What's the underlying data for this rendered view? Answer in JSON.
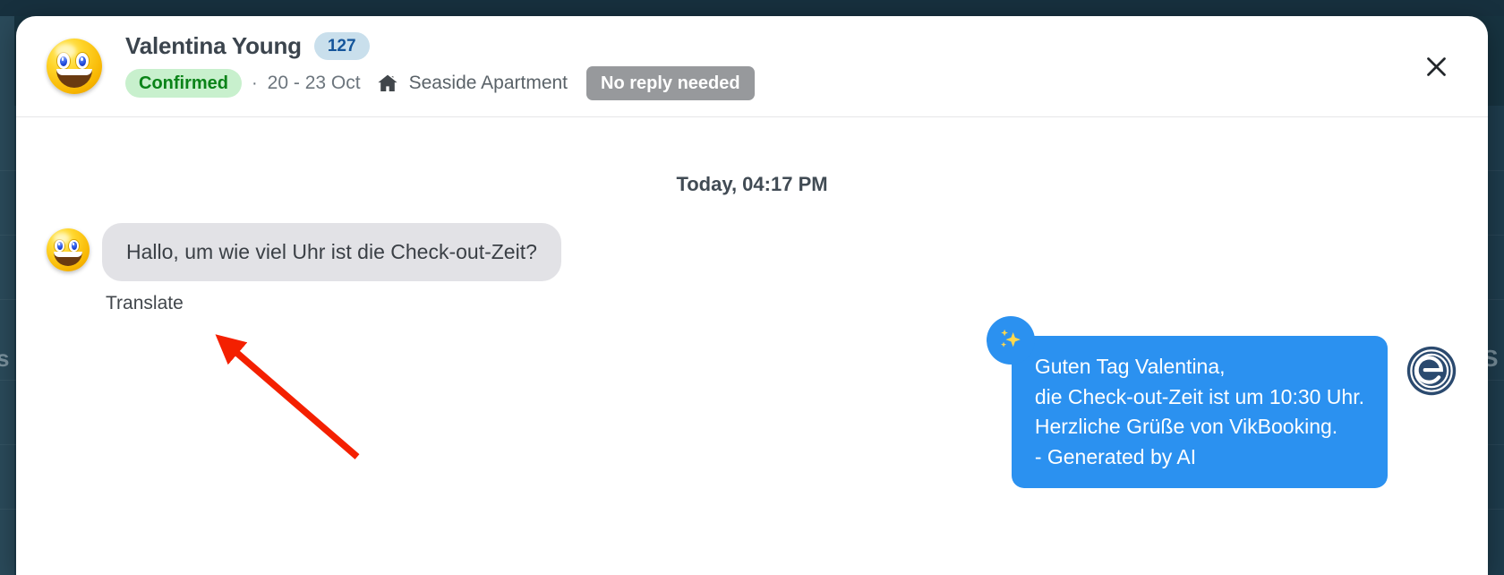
{
  "header": {
    "guest_name": "Valentina Young",
    "booking_id": "127",
    "status": "Confirmed",
    "separator": "·",
    "date_range": "20 - 23 Oct",
    "house_icon": "house-icon",
    "room_name": "Seaside Apartment",
    "reply_badge": "No reply needed",
    "close_icon": "close-icon",
    "avatar_icon": "smiley-avatar",
    "colors": {
      "booking_badge_bg": "#c9dfec",
      "booking_badge_text": "#14559b",
      "status_badge_bg": "#c8f0cd",
      "status_badge_text": "#0a8318",
      "reply_badge_bg": "#97999c",
      "reply_badge_text": "#ffffff"
    }
  },
  "conversation": {
    "day_divider": "Today, 04:17 PM",
    "incoming": {
      "avatar_icon": "smiley-avatar",
      "text": "Hallo, um wie viel Uhr ist die Check-out-Zeit?",
      "translate_label": "Translate",
      "bubble_bg": "#e2e2e6"
    },
    "outgoing": {
      "ai_badge_icon": "sparkles-icon",
      "text": "Guten Tag Valentina,\ndie Check-out-Zeit ist um 10:30 Uhr.\nHerzliche Grüße von VikBooking.\n- Generated by AI",
      "bubble_bg": "#2b91f0",
      "brand_logo_icon": "vikbooking-logo"
    }
  },
  "annotation": {
    "arrow_icon": "red-pointer-arrow",
    "color": "#f42000",
    "points_to": "Translate"
  },
  "backdrop": {
    "ghost_text_left": "s",
    "ghost_text_right": "NS",
    "color": "#1e3c4d"
  }
}
